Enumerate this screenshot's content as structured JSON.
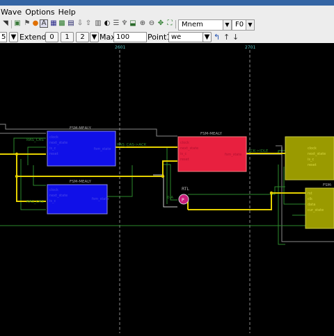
{
  "menu": {
    "items": [
      "Wave",
      "Options",
      "Help"
    ]
  },
  "toolbar": {
    "mnem_value": "Mnem",
    "f_value": "F0"
  },
  "toolbar2": {
    "left_value": "5",
    "extend_label": "Extend:",
    "extend_buttons": [
      "0",
      "1",
      "2"
    ],
    "max_label": "Max:",
    "max_value": "100",
    "point_label": "Point1:",
    "point_value": "we"
  },
  "ruler": {
    "marks": [
      "2601",
      "2701"
    ]
  },
  "schematic": {
    "blocks": [
      {
        "title": "FSM-MEALY",
        "color": "#1010e8"
      },
      {
        "title": "FSM-MEALY",
        "color": "#1010e8"
      },
      {
        "title": "FSM-MEALY",
        "color": "#e8203f"
      },
      {
        "title": "FSM-",
        "color": "#9a9a00"
      },
      {
        "title": "FSM-",
        "color": "#9a9a00"
      }
    ],
    "rtl": {
      "title": "RTL",
      "symbol": "P"
    },
    "net_labels": [
      "RAS_CAS->ACK",
      "RAS_CAS->ACK",
      "ACK->IDLE",
      "RAS_CAS",
      "RAS_CAS",
      "IDLE",
      "IDLE",
      "0-A"
    ],
    "port_labels": [
      "clock",
      "next_state",
      "fsm_state",
      "is_c",
      "reset",
      "rst",
      "clk",
      "data",
      "cur_state",
      "CLK_s"
    ]
  },
  "colors": {
    "wire_yellow": "#e6d200",
    "wire_green": "#2d8a2d",
    "wire_gray": "#8a8a8a",
    "wire_white": "#d0d0d0"
  }
}
